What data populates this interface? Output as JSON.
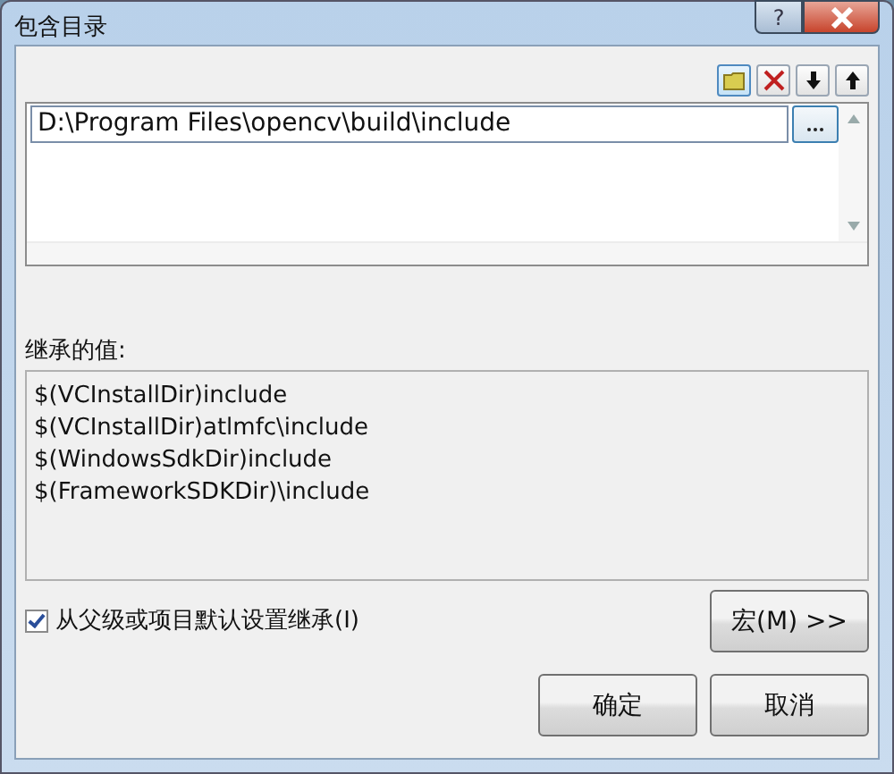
{
  "window": {
    "title": "包含目录",
    "help": "?"
  },
  "directories": [
    {
      "value": "D:\\Program Files\\opencv\\build\\include",
      "editing": true
    }
  ],
  "inherited": {
    "label": "继承的值:",
    "values": [
      "$(VCInstallDir)include",
      "$(VCInstallDir)atlmfc\\include",
      "$(WindowsSdkDir)include",
      "$(FrameworkSDKDir)\\include"
    ]
  },
  "inherit_checkbox": {
    "label": "从父级或项目默认设置继承(I)",
    "checked": true
  },
  "buttons": {
    "macros": "宏(M) >>",
    "ok": "确定",
    "cancel": "取消"
  }
}
